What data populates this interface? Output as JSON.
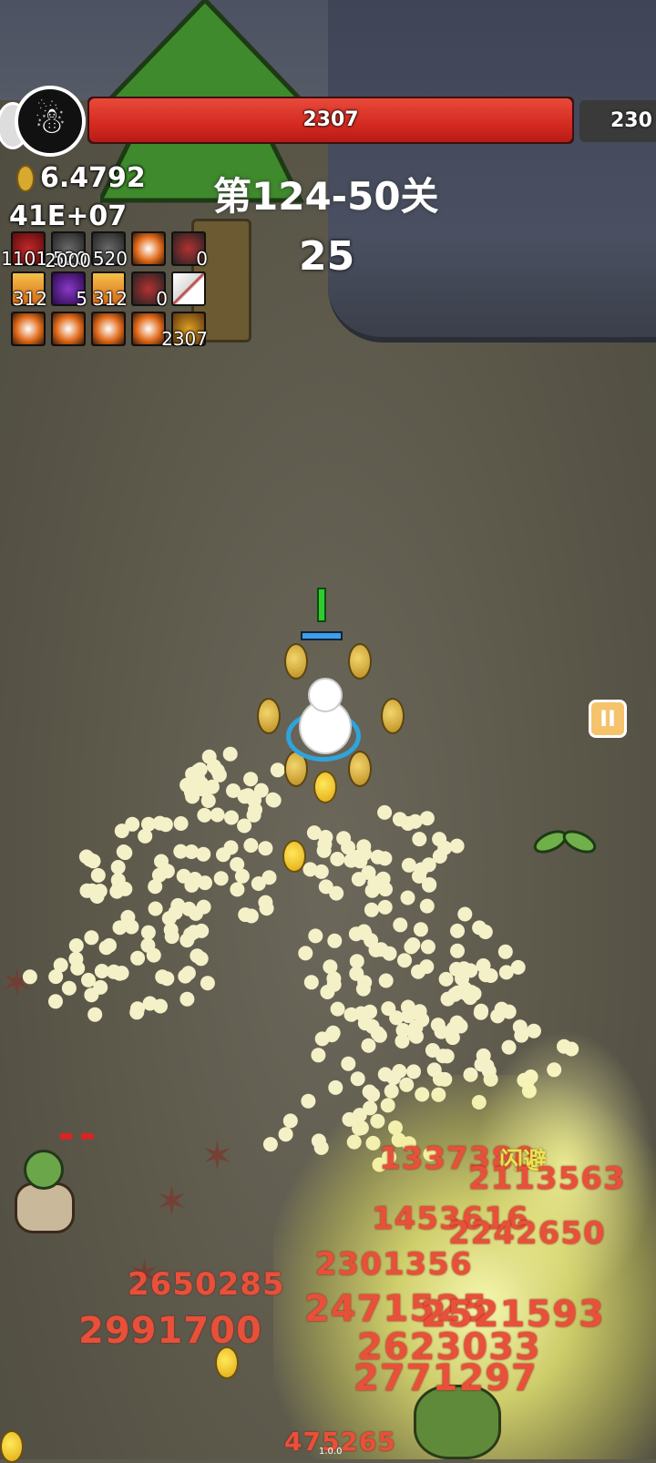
{
  "boss": {
    "hp": "2307",
    "next_hp": "230"
  },
  "currency": {
    "coins": "6.4792",
    "power": "41E+07"
  },
  "stage": {
    "title": "第124-50关",
    "wave": "25"
  },
  "skills": [
    {
      "icon": "heart-skill-icon",
      "value": "1101"
    },
    {
      "icon": "gear-skill-icon",
      "value": "520",
      "extra": "2000"
    },
    {
      "icon": "gear-skill-icon",
      "value": "520"
    },
    {
      "icon": "swirl-skill-icon",
      "value": ""
    },
    {
      "icon": "potion-skill-icon",
      "value": "0"
    },
    {
      "icon": "sun-skill-icon",
      "value": "312"
    },
    {
      "icon": "purple-slash-skill-icon",
      "value": "5"
    },
    {
      "icon": "sun-skill-icon",
      "value": "312"
    },
    {
      "icon": "potion-skill-icon",
      "value": "0"
    },
    {
      "icon": "knife-skill-icon",
      "value": ""
    },
    {
      "icon": "swirl-skill-icon",
      "value": ""
    },
    {
      "icon": "swirl-skill-icon",
      "value": ""
    },
    {
      "icon": "swirl-skill-icon",
      "value": ""
    },
    {
      "icon": "swirl-skill-icon",
      "value": ""
    },
    {
      "icon": "chest-skill-icon",
      "value": "2307"
    }
  ],
  "damage_numbers": [
    "1337380",
    "2113563",
    "1453616",
    "2242650",
    "2301356",
    "2650285",
    "2991700",
    "2471525",
    "2521593",
    "2623033",
    "2771297",
    "475265"
  ],
  "dodge_text": "闪避",
  "version": "1.0.0",
  "pause_label": "II"
}
